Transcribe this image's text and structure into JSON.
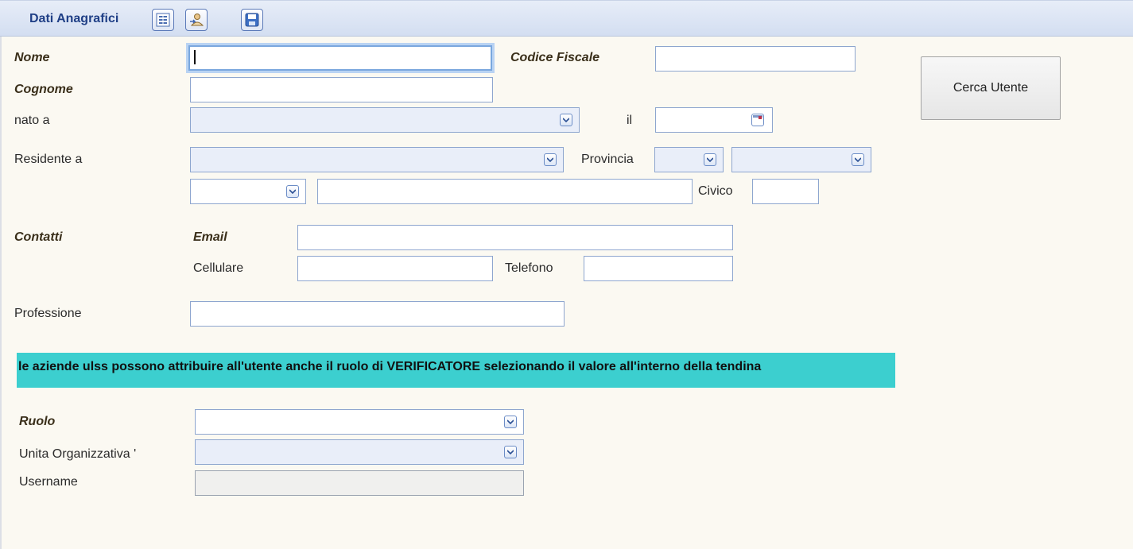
{
  "toolbar": {
    "title": "Dati Anagrafici",
    "buttons": [
      "list-icon",
      "user-edit-icon",
      "save-icon"
    ]
  },
  "form": {
    "nome_label": "Nome",
    "codice_fiscale_label": "Codice Fiscale",
    "cognome_label": "Cognome",
    "nato_a_label": "nato a",
    "il_label": "il",
    "residente_label": "Residente a",
    "provincia_label": "Provincia",
    "civico_label": "Civico",
    "contatti_label": "Contatti",
    "email_label": "Email",
    "cellulare_label": "Cellulare",
    "telefono_label": "Telefono",
    "professione_label": "Professione",
    "ruolo_label": "Ruolo",
    "unita_label": "Unita Organizzativa '",
    "username_label": "Username"
  },
  "cerca_button": "Cerca Utente",
  "banner_text": "le aziende ulss possono attribuire all'utente anche il ruolo di VERIFICATORE selezionando il valore all'interno della tendina",
  "colors": {
    "banner": "#3ccfcf",
    "toolbar_title": "#1f3f86",
    "background": "#fbf9f2"
  }
}
